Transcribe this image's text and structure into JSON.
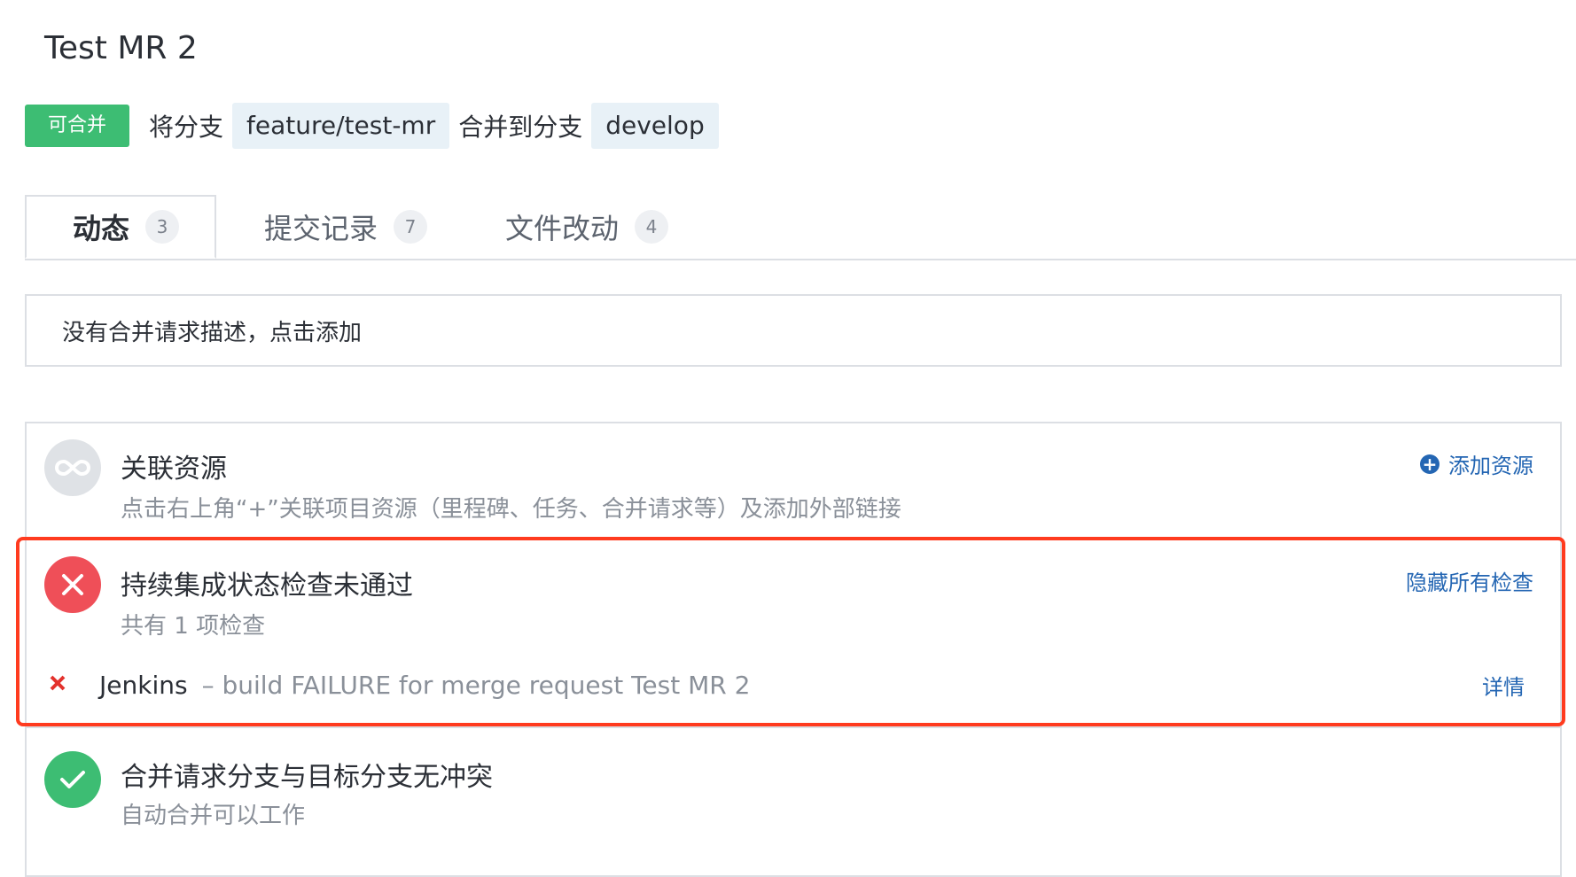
{
  "header": {
    "title": "Test MR 2"
  },
  "merge": {
    "status_label": "可合并",
    "prefix_text": "将分支",
    "source_branch": "feature/test-mr",
    "middle_text": "合并到分支",
    "target_branch": "develop",
    "status_color": "#3dbd73"
  },
  "tabs": [
    {
      "label": "动态",
      "count": "3",
      "active": true
    },
    {
      "label": "提交记录",
      "count": "7",
      "active": false
    },
    {
      "label": "文件改动",
      "count": "4",
      "active": false
    }
  ],
  "description": {
    "placeholder_text": "没有合并请求描述，点击添加"
  },
  "resources": {
    "title": "关联资源",
    "subtitle": "点击右上角“+”关联项目资源（里程碑、任务、合并请求等）及添加外部链接",
    "action_label": "添加资源",
    "icon": "infinity-icon"
  },
  "ci_status": {
    "title": "持续集成状态检查未通过",
    "subtitle": "共有 1 项检查",
    "action_label": "隐藏所有检查",
    "status_color": "#ef4f58",
    "checks": [
      {
        "name": "Jenkins",
        "message": "– build FAILURE for merge request Test MR 2",
        "detail_label": "详情"
      }
    ]
  },
  "conflict_status": {
    "title": "合并请求分支与目标分支无冲突",
    "subtitle": "自动合并可以工作",
    "status_color": "#3dbd73"
  },
  "colors": {
    "link": "#2466b3",
    "highlight": "#ff3b1f"
  }
}
